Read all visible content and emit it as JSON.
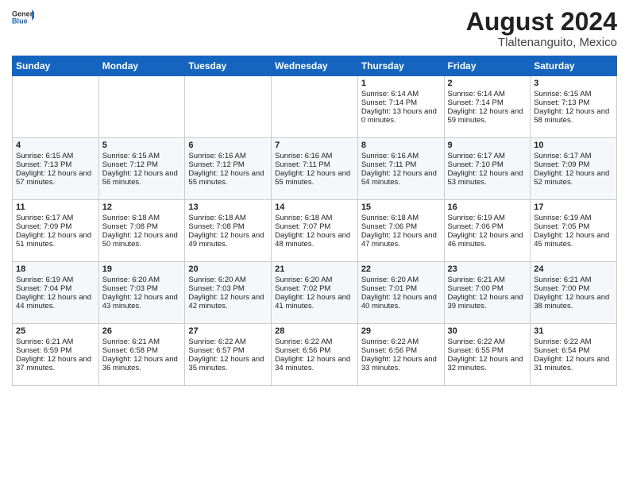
{
  "logo": {
    "general": "General",
    "blue": "Blue"
  },
  "title": "August 2024",
  "subtitle": "Tlaltenanguito, Mexico",
  "days_of_week": [
    "Sunday",
    "Monday",
    "Tuesday",
    "Wednesday",
    "Thursday",
    "Friday",
    "Saturday"
  ],
  "weeks": [
    [
      {
        "day": "",
        "sunrise": "",
        "sunset": "",
        "daylight": ""
      },
      {
        "day": "",
        "sunrise": "",
        "sunset": "",
        "daylight": ""
      },
      {
        "day": "",
        "sunrise": "",
        "sunset": "",
        "daylight": ""
      },
      {
        "day": "",
        "sunrise": "",
        "sunset": "",
        "daylight": ""
      },
      {
        "day": "1",
        "sunrise": "Sunrise: 6:14 AM",
        "sunset": "Sunset: 7:14 PM",
        "daylight": "Daylight: 13 hours and 0 minutes."
      },
      {
        "day": "2",
        "sunrise": "Sunrise: 6:14 AM",
        "sunset": "Sunset: 7:14 PM",
        "daylight": "Daylight: 12 hours and 59 minutes."
      },
      {
        "day": "3",
        "sunrise": "Sunrise: 6:15 AM",
        "sunset": "Sunset: 7:13 PM",
        "daylight": "Daylight: 12 hours and 58 minutes."
      }
    ],
    [
      {
        "day": "4",
        "sunrise": "Sunrise: 6:15 AM",
        "sunset": "Sunset: 7:13 PM",
        "daylight": "Daylight: 12 hours and 57 minutes."
      },
      {
        "day": "5",
        "sunrise": "Sunrise: 6:15 AM",
        "sunset": "Sunset: 7:12 PM",
        "daylight": "Daylight: 12 hours and 56 minutes."
      },
      {
        "day": "6",
        "sunrise": "Sunrise: 6:16 AM",
        "sunset": "Sunset: 7:12 PM",
        "daylight": "Daylight: 12 hours and 55 minutes."
      },
      {
        "day": "7",
        "sunrise": "Sunrise: 6:16 AM",
        "sunset": "Sunset: 7:11 PM",
        "daylight": "Daylight: 12 hours and 55 minutes."
      },
      {
        "day": "8",
        "sunrise": "Sunrise: 6:16 AM",
        "sunset": "Sunset: 7:11 PM",
        "daylight": "Daylight: 12 hours and 54 minutes."
      },
      {
        "day": "9",
        "sunrise": "Sunrise: 6:17 AM",
        "sunset": "Sunset: 7:10 PM",
        "daylight": "Daylight: 12 hours and 53 minutes."
      },
      {
        "day": "10",
        "sunrise": "Sunrise: 6:17 AM",
        "sunset": "Sunset: 7:09 PM",
        "daylight": "Daylight: 12 hours and 52 minutes."
      }
    ],
    [
      {
        "day": "11",
        "sunrise": "Sunrise: 6:17 AM",
        "sunset": "Sunset: 7:09 PM",
        "daylight": "Daylight: 12 hours and 51 minutes."
      },
      {
        "day": "12",
        "sunrise": "Sunrise: 6:18 AM",
        "sunset": "Sunset: 7:08 PM",
        "daylight": "Daylight: 12 hours and 50 minutes."
      },
      {
        "day": "13",
        "sunrise": "Sunrise: 6:18 AM",
        "sunset": "Sunset: 7:08 PM",
        "daylight": "Daylight: 12 hours and 49 minutes."
      },
      {
        "day": "14",
        "sunrise": "Sunrise: 6:18 AM",
        "sunset": "Sunset: 7:07 PM",
        "daylight": "Daylight: 12 hours and 48 minutes."
      },
      {
        "day": "15",
        "sunrise": "Sunrise: 6:18 AM",
        "sunset": "Sunset: 7:06 PM",
        "daylight": "Daylight: 12 hours and 47 minutes."
      },
      {
        "day": "16",
        "sunrise": "Sunrise: 6:19 AM",
        "sunset": "Sunset: 7:06 PM",
        "daylight": "Daylight: 12 hours and 46 minutes."
      },
      {
        "day": "17",
        "sunrise": "Sunrise: 6:19 AM",
        "sunset": "Sunset: 7:05 PM",
        "daylight": "Daylight: 12 hours and 45 minutes."
      }
    ],
    [
      {
        "day": "18",
        "sunrise": "Sunrise: 6:19 AM",
        "sunset": "Sunset: 7:04 PM",
        "daylight": "Daylight: 12 hours and 44 minutes."
      },
      {
        "day": "19",
        "sunrise": "Sunrise: 6:20 AM",
        "sunset": "Sunset: 7:03 PM",
        "daylight": "Daylight: 12 hours and 43 minutes."
      },
      {
        "day": "20",
        "sunrise": "Sunrise: 6:20 AM",
        "sunset": "Sunset: 7:03 PM",
        "daylight": "Daylight: 12 hours and 42 minutes."
      },
      {
        "day": "21",
        "sunrise": "Sunrise: 6:20 AM",
        "sunset": "Sunset: 7:02 PM",
        "daylight": "Daylight: 12 hours and 41 minutes."
      },
      {
        "day": "22",
        "sunrise": "Sunrise: 6:20 AM",
        "sunset": "Sunset: 7:01 PM",
        "daylight": "Daylight: 12 hours and 40 minutes."
      },
      {
        "day": "23",
        "sunrise": "Sunrise: 6:21 AM",
        "sunset": "Sunset: 7:00 PM",
        "daylight": "Daylight: 12 hours and 39 minutes."
      },
      {
        "day": "24",
        "sunrise": "Sunrise: 6:21 AM",
        "sunset": "Sunset: 7:00 PM",
        "daylight": "Daylight: 12 hours and 38 minutes."
      }
    ],
    [
      {
        "day": "25",
        "sunrise": "Sunrise: 6:21 AM",
        "sunset": "Sunset: 6:59 PM",
        "daylight": "Daylight: 12 hours and 37 minutes."
      },
      {
        "day": "26",
        "sunrise": "Sunrise: 6:21 AM",
        "sunset": "Sunset: 6:58 PM",
        "daylight": "Daylight: 12 hours and 36 minutes."
      },
      {
        "day": "27",
        "sunrise": "Sunrise: 6:22 AM",
        "sunset": "Sunset: 6:57 PM",
        "daylight": "Daylight: 12 hours and 35 minutes."
      },
      {
        "day": "28",
        "sunrise": "Sunrise: 6:22 AM",
        "sunset": "Sunset: 6:56 PM",
        "daylight": "Daylight: 12 hours and 34 minutes."
      },
      {
        "day": "29",
        "sunrise": "Sunrise: 6:22 AM",
        "sunset": "Sunset: 6:56 PM",
        "daylight": "Daylight: 12 hours and 33 minutes."
      },
      {
        "day": "30",
        "sunrise": "Sunrise: 6:22 AM",
        "sunset": "Sunset: 6:55 PM",
        "daylight": "Daylight: 12 hours and 32 minutes."
      },
      {
        "day": "31",
        "sunrise": "Sunrise: 6:22 AM",
        "sunset": "Sunset: 6:54 PM",
        "daylight": "Daylight: 12 hours and 31 minutes."
      }
    ]
  ]
}
